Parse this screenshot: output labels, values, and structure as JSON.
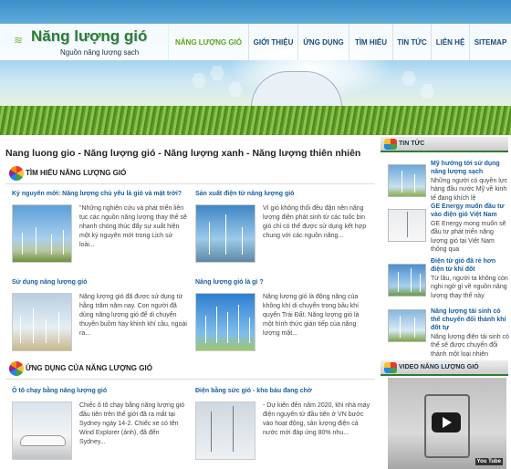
{
  "brand": {
    "title": "Năng lượng gió",
    "subtitle": "Nguồn năng lượng sạch"
  },
  "nav": {
    "items": [
      {
        "label": "NĂNG LƯỢNG GIÓ",
        "active": true
      },
      {
        "label": "GIỚI THIỆU"
      },
      {
        "label": "ỨNG DỤNG"
      },
      {
        "label": "TÌM HIỂU"
      },
      {
        "label": "TIN TỨC"
      },
      {
        "label": "LIÊN HỆ"
      },
      {
        "label": "SITEMAP"
      }
    ]
  },
  "main": {
    "title": "Nang luong gio - Năng lượng gió - Năng lượng xanh - Năng lượng thiên nhiên",
    "section1": {
      "heading": "TÌM HIỂU NĂNG LƯỢNG GIÓ",
      "articles": [
        {
          "title": "Kỷ nguyên mới: Năng lượng chủ yếu là gió và mặt trời?",
          "text": "\"Những nghiên cứu và phát triển liên tục các nguồn năng lượng thay thế sẽ nhanh chóng thúc đẩy sự xuất hiện một kỷ nguyên mới trong Lịch sử loài..."
        },
        {
          "title": "Sản xuất điện từ năng lượng gió",
          "text": "Vì gió không thổi đều đặn nên năng lượng điện phát sinh từ các tuốc bin gió chỉ có thể được sử dụng kết hợp chung với các nguồn năng..."
        },
        {
          "title": "Sử dụng năng lượng gió",
          "text": "Năng lượng gió đã được sử dụng từ hằng trăm năm nay. Con người đã dùng năng lượng gió để di chuyển thuyền buồm hay khinh khí cầu, ngoài ra..."
        },
        {
          "title": "Năng lượng gió là gì ?",
          "text": "Năng lượng gió là động năng của không khí di chuyển trong bầu khí quyển Trái Đất. Năng lượng gió là một hình thức gián tiếp của năng lượng mặt..."
        }
      ]
    },
    "section2": {
      "heading": "ỨNG DỤNG CỦA NĂNG LƯỢNG GIÓ",
      "articles": [
        {
          "title": "Ô tô chạy bằng năng lượng gió",
          "text": "Chiếc ô tô chạy bằng năng lượng gió đầu tiên trên thế giới đã ra mắt tại Sydney ngày 14-2. Chiếc xe có tên Wind Explorer (ảnh), đã đến Sydney..."
        },
        {
          "title": "Điện bằng sức gió - kho báu đang chờ",
          "text": "- Dự kiến đến năm 2020, khi nhà máy điện nguyên tử đầu tiên ở VN bước vào hoạt động, sản lượng điện cả nước mới đáp ứng 80% nhu..."
        }
      ]
    }
  },
  "sidebar": {
    "news_heading": "TIN TỨC",
    "news": [
      {
        "title": "Mỹ hướng tới sử dụng năng lượng sạch",
        "text": "Những người có quyền lực hàng đầu nước Mỹ về kinh tế đang khích lệ"
      },
      {
        "title": "GE Energy muốn đầu tư vào điện gió Việt Nam",
        "text": "GE Energy mong muốn sẽ đầu tư phát triển năng lượng gió tại Việt Nam thông qua"
      },
      {
        "title": "Điện từ gió đã rẻ hơn điện từ khí đốt",
        "text": "Từ lâu, người ta không còn nghi ngờ gì về nguồn năng lượng thay thế này"
      },
      {
        "title": "Năng lượng tái sinh có thể chuyển đổi thành khí đốt tự",
        "text": "Năng lượng điện tái sinh có thể sẽ được chuyển đổi thành một loại nhiên"
      }
    ],
    "video_heading": "VIDEO NĂNG LƯỢNG GIÓ",
    "video_badge": "You Tube"
  }
}
